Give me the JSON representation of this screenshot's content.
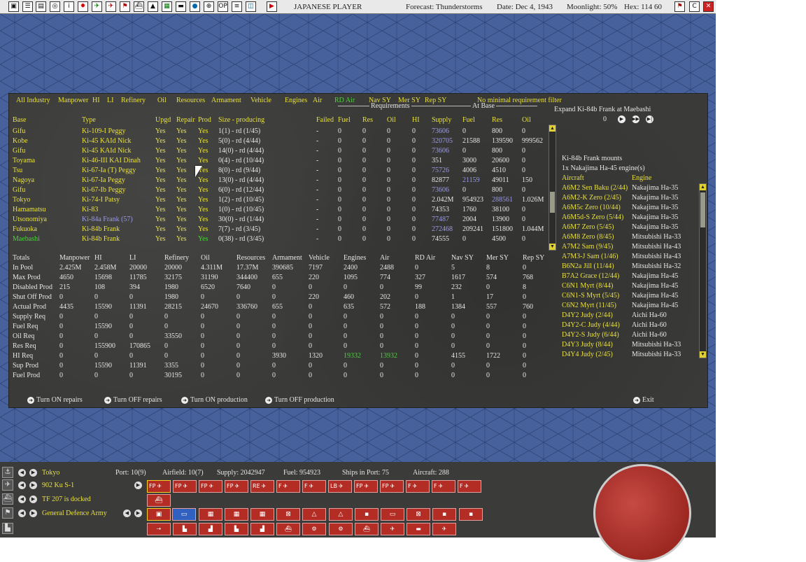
{
  "topbar": {
    "player": "JAPANESE PLAYER",
    "forecast": "Forecast: Thunderstorms",
    "date": "Date: Dec 4, 1943",
    "moonlight": "Moonlight: 50%",
    "hex": "Hex: 114 60",
    "btn_op": "OP"
  },
  "filters": {
    "items": [
      "All Industry",
      "Manpower",
      "HI",
      "LI",
      "Refinery",
      "Oil",
      "Resources",
      "Armament",
      "Vehicle",
      "Engines",
      "Air",
      "RD Air",
      "Nav SY",
      "Mer SY",
      "Rep SY"
    ],
    "active": "RD Air",
    "note": "No minimal requirement filter"
  },
  "groups": {
    "requirements": "Requirements",
    "at_base": "At Base"
  },
  "columns": [
    "Base",
    "Type",
    "Upgd",
    "Repair",
    "Prod",
    "Size - producing",
    "Failed",
    "Fuel",
    "Res",
    "Oil",
    "HI",
    "Supply",
    "Fuel",
    "Res",
    "Oil"
  ],
  "rows": [
    {
      "base": "Gifu",
      "type": "Ki-109-I Peggy",
      "upgd": "Yes",
      "repair": "Yes",
      "prod": "Yes",
      "size": "1(1) - rd (1/45)",
      "failed": "-",
      "rfuel": "0",
      "rres": "0",
      "roil": "0",
      "rhi": "0",
      "supply": "73606",
      "bfuel": "0",
      "bres": "800",
      "boil": "0"
    },
    {
      "base": "Kobe",
      "type": "Ki-45 KAId Nick",
      "upgd": "Yes",
      "repair": "Yes",
      "prod": "Yes",
      "size": "5(0) - rd (4/44)",
      "failed": "-",
      "rfuel": "0",
      "rres": "0",
      "roil": "0",
      "rhi": "0",
      "supply": "320705",
      "bfuel": "21588",
      "bres": "139590",
      "boil": "999562"
    },
    {
      "base": "Gifu",
      "type": "Ki-45 KAId Nick",
      "upgd": "Yes",
      "repair": "Yes",
      "prod": "Yes",
      "size": "14(0) - rd (4/44)",
      "failed": "-",
      "rfuel": "0",
      "rres": "0",
      "roil": "0",
      "rhi": "0",
      "supply": "73606",
      "bfuel": "0",
      "bres": "800",
      "boil": "0"
    },
    {
      "base": "Toyama",
      "type": "Ki-46-III KAI Dinah",
      "upgd": "Yes",
      "repair": "Yes",
      "prod": "Yes",
      "size": "0(4) - rd (10/44)",
      "failed": "-",
      "rfuel": "0",
      "rres": "0",
      "roil": "0",
      "rhi": "0",
      "supply": "351",
      "bfuel": "3000",
      "bres": "20600",
      "boil": "0"
    },
    {
      "base": "Tsu",
      "type": "Ki-67-Ia (T) Peggy",
      "upgd": "Yes",
      "repair": "Yes",
      "prod": "Yes",
      "size": "8(0) - rd (9/44)",
      "failed": "-",
      "rfuel": "0",
      "rres": "0",
      "roil": "0",
      "rhi": "0",
      "supply": "75726",
      "bfuel": "4006",
      "bres": "4510",
      "boil": "0"
    },
    {
      "base": "Nagoya",
      "type": "Ki-67-Ia Peggy",
      "upgd": "Yes",
      "repair": "Yes",
      "prod": "Yes",
      "size": "13(0) - rd (4/44)",
      "failed": "-",
      "rfuel": "0",
      "rres": "0",
      "roil": "0",
      "rhi": "0",
      "supply": "82877",
      "bfuel": "21159",
      "bres": "49011",
      "boil": "150"
    },
    {
      "base": "Gifu",
      "type": "Ki-67-Ib Peggy",
      "upgd": "Yes",
      "repair": "Yes",
      "prod": "Yes",
      "size": "6(0) - rd (12/44)",
      "failed": "-",
      "rfuel": "0",
      "rres": "0",
      "roil": "0",
      "rhi": "0",
      "supply": "73606",
      "bfuel": "0",
      "bres": "800",
      "boil": "0"
    },
    {
      "base": "Tokyo",
      "type": "Ki-74-I Patsy",
      "upgd": "Yes",
      "repair": "Yes",
      "prod": "Yes",
      "size": "1(2) - rd (10/45)",
      "failed": "-",
      "rfuel": "0",
      "rres": "0",
      "roil": "0",
      "rhi": "0",
      "supply": "2.042M",
      "bfuel": "954923",
      "bres": "288561",
      "boil": "1.026M"
    },
    {
      "base": "Hamamatsu",
      "type": "Ki-83",
      "upgd": "Yes",
      "repair": "Yes",
      "prod": "Yes",
      "size": "1(0) - rd (10/45)",
      "failed": "-",
      "rfuel": "0",
      "rres": "0",
      "roil": "0",
      "rhi": "0",
      "supply": "74353",
      "bfuel": "1760",
      "bres": "38100",
      "boil": "0"
    },
    {
      "base": "Utsonomiya",
      "type": "Ki-84a Frank (57)",
      "upgd": "Yes",
      "repair": "Yes",
      "prod": "Yes",
      "size": "30(0) - rd (1/44)",
      "failed": "-",
      "rfuel": "0",
      "rres": "0",
      "roil": "0",
      "rhi": "0",
      "supply": "77487",
      "bfuel": "2004",
      "bres": "13900",
      "boil": "0"
    },
    {
      "base": "Fukuoka",
      "type": "Ki-84b Frank",
      "upgd": "Yes",
      "repair": "Yes",
      "prod": "Yes",
      "size": "7(7) - rd (3/45)",
      "failed": "-",
      "rfuel": "0",
      "rres": "0",
      "roil": "0",
      "rhi": "0",
      "supply": "272468",
      "bfuel": "209241",
      "bres": "151800",
      "boil": "1.044M"
    },
    {
      "base": "Maebashi",
      "type": "Ki-84b Frank",
      "upgd": "Yes",
      "repair": "Yes",
      "prod": "Yes",
      "size": "0(38) - rd (3/45)",
      "failed": "-",
      "rfuel": "0",
      "rres": "0",
      "roil": "0",
      "rhi": "0",
      "supply": "74555",
      "bfuel": "0",
      "bres": "4500",
      "boil": "0"
    }
  ],
  "totals": {
    "headers": [
      "Totals",
      "Manpower",
      "HI",
      "LI",
      "Refinery",
      "Oil",
      "Resources",
      "Armament",
      "Vehicle",
      "Engines",
      "Air",
      "RD Air",
      "Nav SY",
      "Mer SY",
      "Rep SY"
    ],
    "rows": [
      [
        "In Pool",
        "2.425M",
        "2.458M",
        "20000",
        "20000",
        "4.311M",
        "17.37M",
        "390685",
        "7197",
        "2400",
        "2488",
        "0",
        "5",
        "8",
        "0"
      ],
      [
        "Max Prod",
        "4650",
        "15698",
        "11785",
        "32175",
        "31190",
        "344400",
        "655",
        "220",
        "1095",
        "774",
        "327",
        "1617",
        "574",
        "768"
      ],
      [
        "Disabled Prod",
        "215",
        "108",
        "394",
        "1980",
        "6520",
        "7640",
        "0",
        "0",
        "0",
        "0",
        "99",
        "232",
        "0",
        "8"
      ],
      [
        "Shut Off Prod",
        "0",
        "0",
        "0",
        "1980",
        "0",
        "0",
        "0",
        "220",
        "460",
        "202",
        "0",
        "1",
        "17",
        "0"
      ],
      [
        "Actual Prod",
        "4435",
        "15590",
        "11391",
        "28215",
        "24670",
        "336760",
        "655",
        "0",
        "635",
        "572",
        "188",
        "1384",
        "557",
        "760"
      ],
      [
        "Supply Req",
        "0",
        "0",
        "0",
        "0",
        "0",
        "0",
        "0",
        "0",
        "0",
        "0",
        "0",
        "0",
        "0",
        "0"
      ],
      [
        "Fuel Req",
        "0",
        "15590",
        "0",
        "0",
        "0",
        "0",
        "0",
        "0",
        "0",
        "0",
        "0",
        "0",
        "0",
        "0"
      ],
      [
        "Oil Req",
        "0",
        "0",
        "0",
        "33550",
        "0",
        "0",
        "0",
        "0",
        "0",
        "0",
        "0",
        "0",
        "0",
        "0"
      ],
      [
        "Res Req",
        "0",
        "155900",
        "170865",
        "0",
        "0",
        "0",
        "0",
        "0",
        "0",
        "0",
        "0",
        "0",
        "0",
        "0"
      ],
      [
        "HI Req",
        "0",
        "0",
        "0",
        "0",
        "0",
        "0",
        "3930",
        "1320",
        "19332",
        "13932",
        "0",
        "4155",
        "1722",
        "0"
      ],
      [
        "Sup Prod",
        "0",
        "15590",
        "11391",
        "3355",
        "0",
        "0",
        "0",
        "0",
        "0",
        "0",
        "0",
        "0",
        "0",
        "0"
      ],
      [
        "Fuel Prod",
        "0",
        "0",
        "0",
        "30195",
        "0",
        "0",
        "0",
        "0",
        "0",
        "0",
        "0",
        "0",
        "0",
        "0"
      ]
    ]
  },
  "expand": {
    "title": "Expand Ki-84b Frank at Maebashi",
    "value": "0",
    "mounts": "Ki-84b Frank mounts",
    "engine_req": "1x Nakajima Ha-45 engine(s)",
    "col_aircraft": "Aircraft",
    "col_engine": "Engine",
    "list": [
      [
        "A6M2 Sen Baku (2/44)",
        "Nakajima Ha-35"
      ],
      [
        "A6M2-K Zero (2/45)",
        "Nakajima Ha-35"
      ],
      [
        "A6M5c Zero (10/44)",
        "Nakajima Ha-35"
      ],
      [
        "A6M5d-S Zero (5/44)",
        "Nakajima Ha-35"
      ],
      [
        "A6M7 Zero (5/45)",
        "Nakajima Ha-35"
      ],
      [
        "A6M8 Zero (8/45)",
        "Mitsubishi Ha-33"
      ],
      [
        "A7M2 Sam (9/45)",
        "Mitsubishi Ha-43"
      ],
      [
        "A7M3-J Sam (1/46)",
        "Mitsubishi Ha-43"
      ],
      [
        "B6N2a Jill (11/44)",
        "Mitsubishi Ha-32"
      ],
      [
        "B7A2 Grace (12/44)",
        "Nakajima Ha-45"
      ],
      [
        "C6N1 Myrt (8/44)",
        "Nakajima Ha-45"
      ],
      [
        "C6N1-S Myrt (5/45)",
        "Nakajima Ha-45"
      ],
      [
        "C6N2 Myrt (11/45)",
        "Nakajima Ha-45"
      ],
      [
        "D4Y2 Judy (2/44)",
        "Aichi Ha-60"
      ],
      [
        "D4Y2-C Judy (4/44)",
        "Aichi Ha-60"
      ],
      [
        "D4Y2-S Judy (6/44)",
        "Aichi Ha-60"
      ],
      [
        "D4Y3 Judy (8/44)",
        "Mitsubishi Ha-33"
      ],
      [
        "D4Y4 Judy (2/45)",
        "Mitsubishi Ha-33"
      ]
    ]
  },
  "actions": {
    "repairs_on": "Turn ON repairs",
    "repairs_off": "Turn OFF repairs",
    "prod_on": "Turn ON production",
    "prod_off": "Turn OFF production",
    "exit": "Exit"
  },
  "bottom": {
    "base": "Tokyo",
    "port": "Port: 10(9)",
    "airfield": "Airfield: 10(7)",
    "supply": "Supply: 2042947",
    "fuel": "Fuel: 954923",
    "ships": "Ships in Port: 75",
    "aircraft": "Aircraft: 288",
    "air_group": "902 Ku S-1",
    "task_force": "TF 207 is docked",
    "army": "General Defence Army",
    "air_units": [
      "FP",
      "FP",
      "FP",
      "FP",
      "RE",
      "F",
      "F",
      "LB",
      "FP",
      "FP",
      "F",
      "F",
      "F"
    ]
  }
}
